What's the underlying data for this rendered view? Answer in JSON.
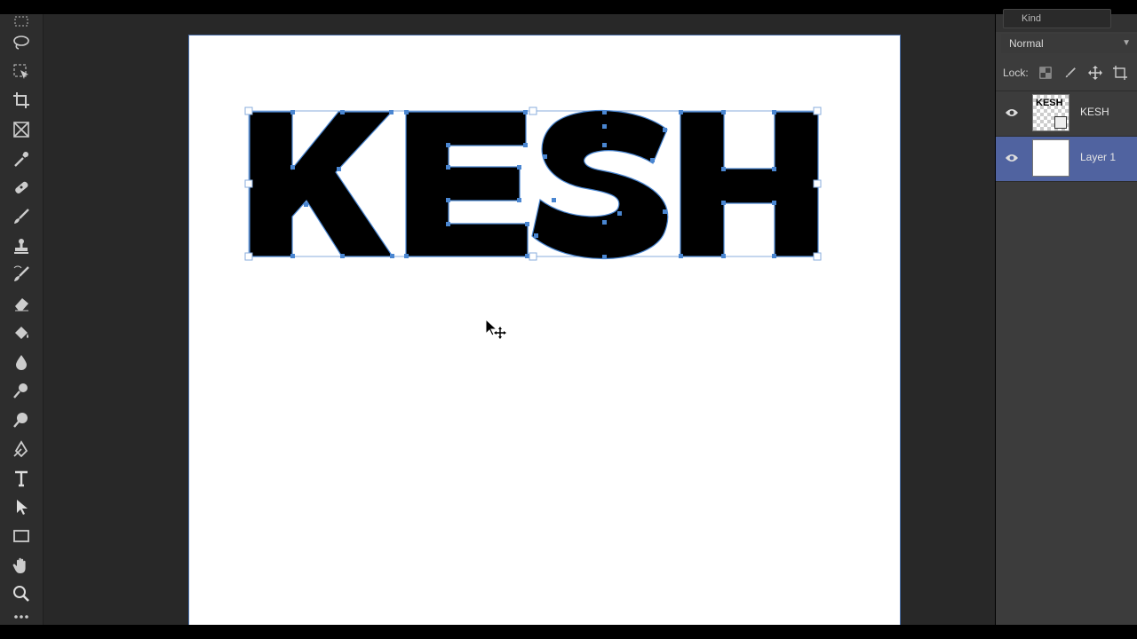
{
  "layers_panel": {
    "filter_placeholder": "Kind",
    "blend_mode": "Normal",
    "lock_label": "Lock:",
    "layers": [
      {
        "name": "KESH",
        "thumbnail_text": "KESH",
        "selected": false
      },
      {
        "name": "Layer 1",
        "selected": true
      }
    ]
  },
  "tools": [
    {
      "id": "lasso",
      "icon": "lasso-icon"
    },
    {
      "id": "object-selection",
      "icon": "object-selection-icon"
    },
    {
      "id": "crop",
      "icon": "crop-icon"
    },
    {
      "id": "frame",
      "icon": "frame-icon"
    },
    {
      "id": "eyedropper",
      "icon": "eyedropper-icon"
    },
    {
      "id": "healing-brush",
      "icon": "bandage-icon"
    },
    {
      "id": "brush",
      "icon": "brush-icon"
    },
    {
      "id": "clone-stamp",
      "icon": "stamp-icon"
    },
    {
      "id": "history-brush",
      "icon": "history-brush-icon"
    },
    {
      "id": "eraser",
      "icon": "eraser-icon"
    },
    {
      "id": "paint-bucket",
      "icon": "paint-bucket-icon"
    },
    {
      "id": "blur",
      "icon": "drop-icon"
    },
    {
      "id": "dodge",
      "icon": "dodge-icon"
    },
    {
      "id": "zoom-dodge",
      "icon": "sponge-icon"
    },
    {
      "id": "pen",
      "icon": "pen-icon"
    },
    {
      "id": "type",
      "icon": "type-icon",
      "label": "T"
    },
    {
      "id": "path-selection",
      "icon": "arrow-icon"
    },
    {
      "id": "rectangle",
      "icon": "rectangle-icon"
    },
    {
      "id": "hand",
      "icon": "hand-icon"
    },
    {
      "id": "zoom",
      "icon": "zoom-icon"
    },
    {
      "id": "more",
      "icon": "more-icon"
    }
  ],
  "canvas": {
    "text": "KESH",
    "colors": {
      "text": "#000000",
      "selection": "#4a86d1",
      "background": "#ffffff"
    }
  },
  "colors": {
    "panel_bg": "#3c3c3c",
    "workspace_bg": "#282828",
    "selected_layer": "#5063a0"
  }
}
